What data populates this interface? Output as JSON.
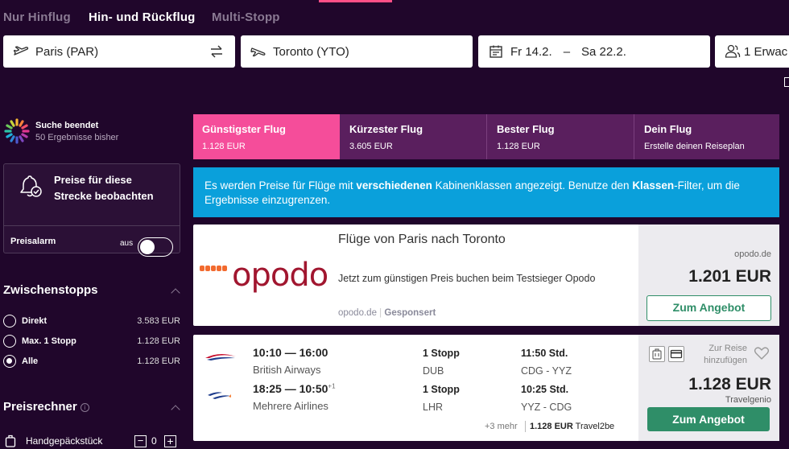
{
  "trip_tabs": [
    {
      "label": "Nur Hinflug",
      "active": false
    },
    {
      "label": "Hin- und Rückflug",
      "active": true
    },
    {
      "label": "Multi-Stopp",
      "active": false
    }
  ],
  "search": {
    "origin": "Paris (PAR)",
    "destination": "Toronto (YTO)",
    "date_out": "Fr 14.2.",
    "date_sep": "–",
    "date_back": "Sa 22.2.",
    "passengers": "1 Erwac"
  },
  "sidebar": {
    "status_title": "Suche beendet",
    "status_sub": "50 Ergebnisse bisher",
    "alarm_title": "Preise für diese Strecke beobachten",
    "alarm_label": "Preisalarm",
    "alarm_toggle": "aus",
    "stops_title": "Zwischenstopps",
    "stops": [
      {
        "label": "Direkt",
        "price": "3.583 EUR",
        "checked": false
      },
      {
        "label": "Max. 1 Stopp",
        "price": "1.128 EUR",
        "checked": false
      },
      {
        "label": "Alle",
        "price": "1.128 EUR",
        "checked": true
      }
    ],
    "calc_title": "Preisrechner",
    "hand_luggage": "Handgepäckstück",
    "hand_luggage_count": "0"
  },
  "sort_tabs": [
    {
      "name": "Günstigster Flug",
      "sub": "1.128 EUR",
      "active": true
    },
    {
      "name": "Kürzester Flug",
      "sub": "3.605 EUR",
      "active": false
    },
    {
      "name": "Bester Flug",
      "sub": "1.128 EUR",
      "active": false
    },
    {
      "name": "Dein Flug",
      "sub": "Erstelle deinen Reiseplan",
      "active": false
    }
  ],
  "banner": {
    "p1": "Es werden Preise für Flüge mit ",
    "b1": "verschiedenen",
    "p2": " Kabinenklassen angezeigt. Benutze den ",
    "b2": "Klassen",
    "p3": "-Filter, um die Ergebnisse einzugrenzen."
  },
  "ad": {
    "logo": "opodo",
    "title": "Flüge von Paris nach Toronto",
    "text": "Jetzt zum günstigen Preis buchen beim Testsieger Opodo",
    "site": "opodo.de",
    "sponsored": "Gesponsert",
    "site_right": "opodo.de",
    "price": "1.201 EUR",
    "button": "Zum Angebot"
  },
  "flight": {
    "legs": [
      {
        "times": "10:10 — 16:00",
        "plus": "",
        "airline": "British Airways",
        "stops": "1 Stopp",
        "via": "DUB",
        "duration": "11:50 Std.",
        "route": "CDG - YYZ"
      },
      {
        "times": "18:25 — 10:50",
        "plus": "+1",
        "airline": "Mehrere Airlines",
        "stops": "1 Stopp",
        "via": "LHR",
        "duration": "10:25 Std.",
        "route": "YYZ - CDG"
      }
    ],
    "more": "+3 mehr",
    "alt_price": "1.128 EUR",
    "alt_provider": "Travel2be",
    "add_trip_1": "Zur Reise",
    "add_trip_2": "hinzufügen",
    "price": "1.128 EUR",
    "provider": "Travelgenio",
    "button": "Zum Angebot"
  }
}
